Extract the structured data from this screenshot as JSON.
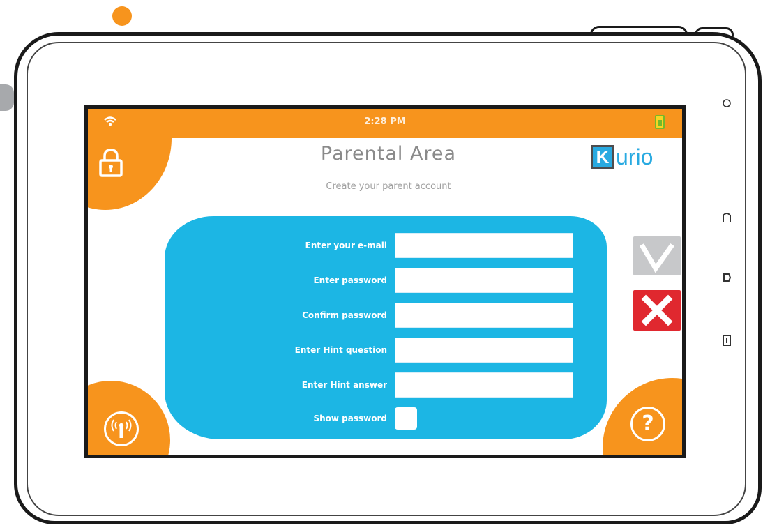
{
  "status_bar": {
    "time": "2:28 PM"
  },
  "header": {
    "title": "Parental Area",
    "subtitle": "Create your parent account",
    "brand_initial": "K",
    "brand_rest": "urio"
  },
  "form": {
    "fields": [
      {
        "label": "Enter your e-mail",
        "value": ""
      },
      {
        "label": "Enter password",
        "value": ""
      },
      {
        "label": "Confirm password",
        "value": ""
      },
      {
        "label": "Enter Hint question",
        "value": ""
      },
      {
        "label": "Enter Hint answer",
        "value": ""
      }
    ],
    "show_password_label": "Show password",
    "show_password_checked": false
  },
  "actions": {
    "help_symbol": "?"
  },
  "icons": {
    "status_left": "wifi-icon",
    "status_right": "battery-icon",
    "top_left": "lock-icon",
    "bottom_left": "parental-control-icon",
    "bottom_right": "help-icon",
    "confirm": "checkmark-icon",
    "cancel": "close-icon",
    "hardware": [
      "camera-icon",
      "home-icon",
      "back-icon",
      "menu-icon"
    ]
  },
  "colors": {
    "accent_orange": "#f7941d",
    "form_blue": "#1cb6e4",
    "brand_blue": "#29aae1",
    "confirm_gray": "#c7c8ca",
    "cancel_red": "#e0282f"
  }
}
